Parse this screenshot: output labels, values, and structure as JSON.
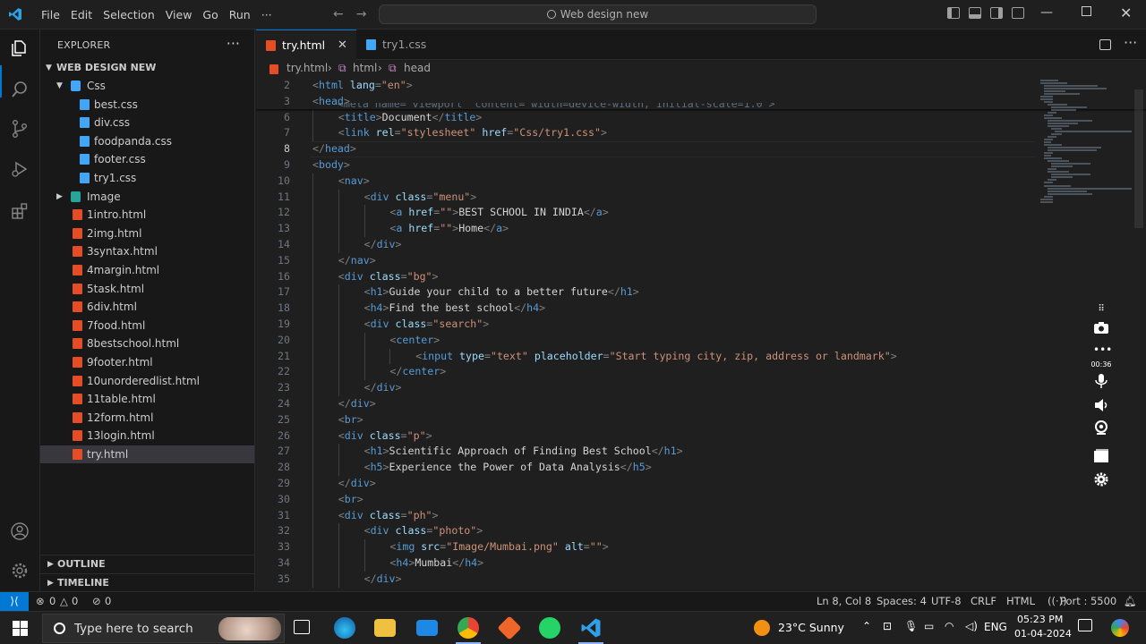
{
  "titlebar": {
    "menu": [
      "File",
      "Edit",
      "Selection",
      "View",
      "Go",
      "Run",
      "···"
    ],
    "search": "Web design new"
  },
  "sidebar": {
    "title": "EXPLORER",
    "more": "···",
    "root": "WEB DESIGN NEW",
    "css_folder": "Css",
    "css_files": [
      "best.css",
      "div.css",
      "foodpanda.css",
      "footer.css",
      "try1.css"
    ],
    "image_folder": "Image",
    "html_files": [
      "1intro.html",
      "2img.html",
      "3syntax.html",
      "4margin.html",
      "5task.html",
      "6div.html",
      "7food.html",
      "8bestschool.html",
      "9footer.html",
      "10unorderedlist.html",
      "11table.html",
      "12form.html",
      "13login.html",
      "try.html"
    ],
    "selected": "try.html",
    "outline": "OUTLINE",
    "timeline": "TIMELINE"
  },
  "tabs": [
    {
      "label": "try.html",
      "active": true
    },
    {
      "label": "try1.css",
      "active": false
    }
  ],
  "breadcrumb": {
    "file": "try.html",
    "el1": "html",
    "el2": "head"
  },
  "editor": {
    "current_line": 8,
    "lines": [
      {
        "n": 2,
        "indent": 0,
        "code": [
          [
            "t",
            "<"
          ],
          [
            "tn",
            "html"
          ],
          [
            "an",
            " lang"
          ],
          [
            "t",
            "="
          ],
          [
            "av",
            "\"en\""
          ],
          [
            "t",
            ">"
          ]
        ]
      },
      {
        "n": 3,
        "indent": 0,
        "code": [
          [
            "t",
            "<"
          ],
          [
            "tn",
            "head"
          ],
          [
            "t",
            ">"
          ]
        ]
      },
      {
        "n": 6,
        "indent": 1,
        "code": [
          [
            "t",
            "<"
          ],
          [
            "tn",
            "title"
          ],
          [
            "t",
            ">"
          ],
          [
            "tx",
            "Document"
          ],
          [
            "t",
            "</"
          ],
          [
            "tn",
            "title"
          ],
          [
            "t",
            ">"
          ]
        ]
      },
      {
        "n": 7,
        "indent": 1,
        "code": [
          [
            "t",
            "<"
          ],
          [
            "tn",
            "link"
          ],
          [
            "an",
            " rel"
          ],
          [
            "t",
            "="
          ],
          [
            "av",
            "\"stylesheet\""
          ],
          [
            "an",
            " href"
          ],
          [
            "t",
            "="
          ],
          [
            "av",
            "\"Css/try1.css\""
          ],
          [
            "t",
            ">"
          ]
        ]
      },
      {
        "n": 8,
        "indent": 0,
        "code": [
          [
            "t",
            "</"
          ],
          [
            "tn",
            "head"
          ],
          [
            "t",
            ">"
          ]
        ]
      },
      {
        "n": 9,
        "indent": 0,
        "code": [
          [
            "t",
            "<"
          ],
          [
            "tn",
            "body"
          ],
          [
            "t",
            ">"
          ]
        ]
      },
      {
        "n": 10,
        "indent": 1,
        "code": [
          [
            "t",
            "<"
          ],
          [
            "tn",
            "nav"
          ],
          [
            "t",
            ">"
          ]
        ]
      },
      {
        "n": 11,
        "indent": 2,
        "code": [
          [
            "t",
            "<"
          ],
          [
            "tn",
            "div"
          ],
          [
            "an",
            " class"
          ],
          [
            "t",
            "="
          ],
          [
            "av",
            "\"menu\""
          ],
          [
            "t",
            ">"
          ]
        ]
      },
      {
        "n": 12,
        "indent": 3,
        "code": [
          [
            "t",
            "<"
          ],
          [
            "tn",
            "a"
          ],
          [
            "an",
            " href"
          ],
          [
            "t",
            "="
          ],
          [
            "av",
            "\"\""
          ],
          [
            "t",
            ">"
          ],
          [
            "tx",
            "BEST SCHOOL IN INDIA"
          ],
          [
            "t",
            "</"
          ],
          [
            "tn",
            "a"
          ],
          [
            "t",
            ">"
          ]
        ]
      },
      {
        "n": 13,
        "indent": 3,
        "code": [
          [
            "t",
            "<"
          ],
          [
            "tn",
            "a"
          ],
          [
            "an",
            " href"
          ],
          [
            "t",
            "="
          ],
          [
            "av",
            "\"\""
          ],
          [
            "t",
            ">"
          ],
          [
            "tx",
            "Home"
          ],
          [
            "t",
            "</"
          ],
          [
            "tn",
            "a"
          ],
          [
            "t",
            ">"
          ]
        ]
      },
      {
        "n": 14,
        "indent": 2,
        "code": [
          [
            "t",
            "</"
          ],
          [
            "tn",
            "div"
          ],
          [
            "t",
            ">"
          ]
        ]
      },
      {
        "n": 15,
        "indent": 1,
        "code": [
          [
            "t",
            "</"
          ],
          [
            "tn",
            "nav"
          ],
          [
            "t",
            ">"
          ]
        ]
      },
      {
        "n": 16,
        "indent": 1,
        "code": [
          [
            "t",
            "<"
          ],
          [
            "tn",
            "div"
          ],
          [
            "an",
            " class"
          ],
          [
            "t",
            "="
          ],
          [
            "av",
            "\"bg\""
          ],
          [
            "t",
            ">"
          ]
        ]
      },
      {
        "n": 17,
        "indent": 2,
        "code": [
          [
            "t",
            "<"
          ],
          [
            "tn",
            "h1"
          ],
          [
            "t",
            ">"
          ],
          [
            "tx",
            "Guide your child to a better future"
          ],
          [
            "t",
            "</"
          ],
          [
            "tn",
            "h1"
          ],
          [
            "t",
            ">"
          ]
        ]
      },
      {
        "n": 18,
        "indent": 2,
        "code": [
          [
            "t",
            "<"
          ],
          [
            "tn",
            "h4"
          ],
          [
            "t",
            ">"
          ],
          [
            "tx",
            "Find the best school"
          ],
          [
            "t",
            "</"
          ],
          [
            "tn",
            "h4"
          ],
          [
            "t",
            ">"
          ]
        ]
      },
      {
        "n": 19,
        "indent": 2,
        "code": [
          [
            "t",
            "<"
          ],
          [
            "tn",
            "div"
          ],
          [
            "an",
            " class"
          ],
          [
            "t",
            "="
          ],
          [
            "av",
            "\"search\""
          ],
          [
            "t",
            ">"
          ]
        ]
      },
      {
        "n": 20,
        "indent": 3,
        "code": [
          [
            "t",
            "<"
          ],
          [
            "tn",
            "center"
          ],
          [
            "t",
            ">"
          ]
        ]
      },
      {
        "n": 21,
        "indent": 4,
        "code": [
          [
            "t",
            "<"
          ],
          [
            "tn",
            "input"
          ],
          [
            "an",
            " type"
          ],
          [
            "t",
            "="
          ],
          [
            "av",
            "\"text\""
          ],
          [
            "an",
            " placeholder"
          ],
          [
            "t",
            "="
          ],
          [
            "av",
            "\"Start typing city, zip, address or landmark\""
          ],
          [
            "t",
            ">"
          ]
        ]
      },
      {
        "n": 22,
        "indent": 3,
        "code": [
          [
            "t",
            "</"
          ],
          [
            "tn",
            "center"
          ],
          [
            "t",
            ">"
          ]
        ]
      },
      {
        "n": 23,
        "indent": 2,
        "code": [
          [
            "t",
            "</"
          ],
          [
            "tn",
            "div"
          ],
          [
            "t",
            ">"
          ]
        ]
      },
      {
        "n": 24,
        "indent": 1,
        "code": [
          [
            "t",
            "</"
          ],
          [
            "tn",
            "div"
          ],
          [
            "t",
            ">"
          ]
        ]
      },
      {
        "n": 25,
        "indent": 1,
        "code": [
          [
            "t",
            "<"
          ],
          [
            "tn",
            "br"
          ],
          [
            "t",
            ">"
          ]
        ]
      },
      {
        "n": 26,
        "indent": 1,
        "code": [
          [
            "t",
            "<"
          ],
          [
            "tn",
            "div"
          ],
          [
            "an",
            " class"
          ],
          [
            "t",
            "="
          ],
          [
            "av",
            "\"p\""
          ],
          [
            "t",
            ">"
          ]
        ]
      },
      {
        "n": 27,
        "indent": 2,
        "code": [
          [
            "t",
            "<"
          ],
          [
            "tn",
            "h1"
          ],
          [
            "t",
            ">"
          ],
          [
            "tx",
            "Scientific Approach of Finding Best School"
          ],
          [
            "t",
            "</"
          ],
          [
            "tn",
            "h1"
          ],
          [
            "t",
            ">"
          ]
        ]
      },
      {
        "n": 28,
        "indent": 2,
        "code": [
          [
            "t",
            "<"
          ],
          [
            "tn",
            "h5"
          ],
          [
            "t",
            ">"
          ],
          [
            "tx",
            "Experience the Power of Data Analysis"
          ],
          [
            "t",
            "</"
          ],
          [
            "tn",
            "h5"
          ],
          [
            "t",
            ">"
          ]
        ]
      },
      {
        "n": 29,
        "indent": 1,
        "code": [
          [
            "t",
            "</"
          ],
          [
            "tn",
            "div"
          ],
          [
            "t",
            ">"
          ]
        ]
      },
      {
        "n": 30,
        "indent": 1,
        "code": [
          [
            "t",
            "<"
          ],
          [
            "tn",
            "br"
          ],
          [
            "t",
            ">"
          ]
        ]
      },
      {
        "n": 31,
        "indent": 1,
        "code": [
          [
            "t",
            "<"
          ],
          [
            "tn",
            "div"
          ],
          [
            "an",
            " class"
          ],
          [
            "t",
            "="
          ],
          [
            "av",
            "\"ph\""
          ],
          [
            "t",
            ">"
          ]
        ]
      },
      {
        "n": 32,
        "indent": 2,
        "code": [
          [
            "t",
            "<"
          ],
          [
            "tn",
            "div"
          ],
          [
            "an",
            " class"
          ],
          [
            "t",
            "="
          ],
          [
            "av",
            "\"photo\""
          ],
          [
            "t",
            ">"
          ]
        ]
      },
      {
        "n": 33,
        "indent": 3,
        "code": [
          [
            "t",
            "<"
          ],
          [
            "tn",
            "img"
          ],
          [
            "an",
            " src"
          ],
          [
            "t",
            "="
          ],
          [
            "av",
            "\"Image/Mumbai.png\""
          ],
          [
            "an",
            " alt"
          ],
          [
            "t",
            "="
          ],
          [
            "av",
            "\"\""
          ],
          [
            "t",
            ">"
          ]
        ]
      },
      {
        "n": 34,
        "indent": 3,
        "code": [
          [
            "t",
            "<"
          ],
          [
            "tn",
            "h4"
          ],
          [
            "t",
            ">"
          ],
          [
            "tx",
            "Mumbai"
          ],
          [
            "t",
            "</"
          ],
          [
            "tn",
            "h4"
          ],
          [
            "t",
            ">"
          ]
        ]
      },
      {
        "n": 35,
        "indent": 2,
        "code": [
          [
            "t",
            "</"
          ],
          [
            "tn",
            "div"
          ],
          [
            "t",
            ">"
          ]
        ]
      }
    ]
  },
  "recorder": {
    "timer": "00:36"
  },
  "statusbar": {
    "errors": "0",
    "warnings": "0",
    "ports": "0",
    "position": "Ln 8, Col 8",
    "spaces": "Spaces: 4",
    "encoding": "UTF-8",
    "eol": "CRLF",
    "language": "HTML",
    "port": "Port : 5500"
  },
  "taskbar": {
    "search_placeholder": "Type here to search",
    "weather": "23°C  Sunny",
    "lang": "ENG",
    "time": "05:23 PM",
    "date": "01-04-2024"
  }
}
